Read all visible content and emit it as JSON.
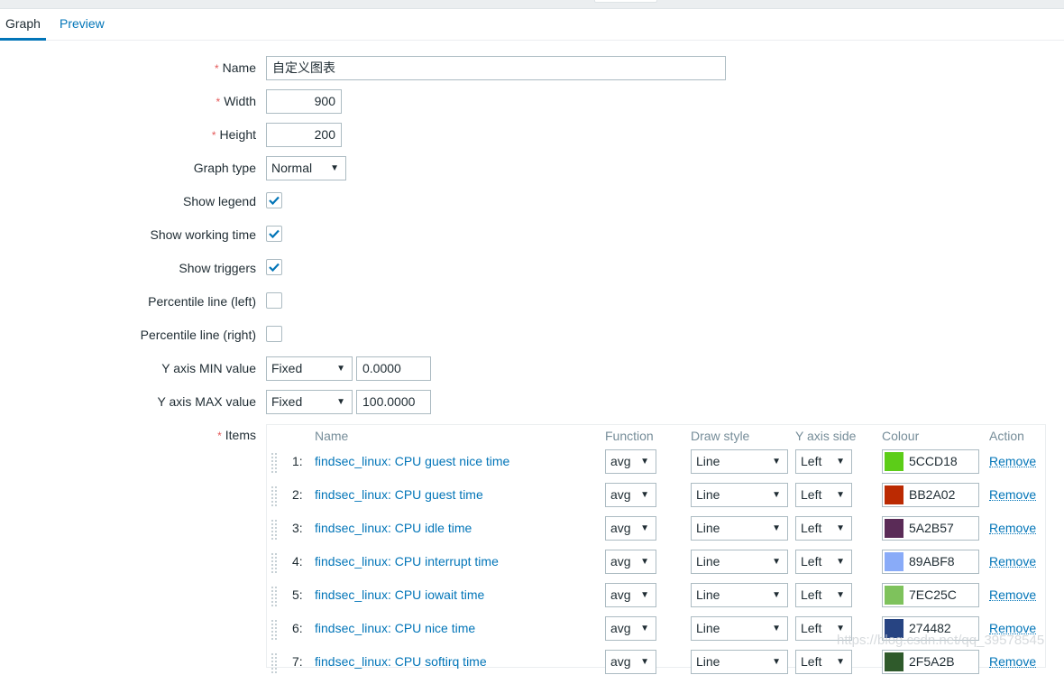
{
  "tabs": [
    {
      "label": "Graph",
      "active": true
    },
    {
      "label": "Preview",
      "active": false
    }
  ],
  "form": {
    "name": {
      "label": "Name",
      "required": true,
      "value": "自定义图表"
    },
    "width": {
      "label": "Width",
      "required": true,
      "value": "900"
    },
    "height": {
      "label": "Height",
      "required": true,
      "value": "200"
    },
    "graph_type": {
      "label": "Graph type",
      "value": "Normal"
    },
    "show_legend": {
      "label": "Show legend",
      "checked": true
    },
    "show_working_time": {
      "label": "Show working time",
      "checked": true
    },
    "show_triggers": {
      "label": "Show triggers",
      "checked": true
    },
    "percentile_left": {
      "label": "Percentile line (left)",
      "checked": false
    },
    "percentile_right": {
      "label": "Percentile line (right)",
      "checked": false
    },
    "y_min": {
      "label": "Y axis MIN value",
      "type": "Fixed",
      "value": "0.0000"
    },
    "y_max": {
      "label": "Y axis MAX value",
      "type": "Fixed",
      "value": "100.0000"
    },
    "items_label": "Items",
    "required_marker": "*"
  },
  "items_table": {
    "headers": {
      "name": "Name",
      "function": "Function",
      "draw_style": "Draw style",
      "y_axis_side": "Y axis side",
      "colour": "Colour",
      "action": "Action"
    },
    "rows": [
      {
        "num": "1:",
        "name": "findsec_linux: CPU guest nice time",
        "function": "avg",
        "draw_style": "Line",
        "y_axis_side": "Left",
        "colour": "5CCD18",
        "colour_hex": "#5CCD18",
        "action": "Remove"
      },
      {
        "num": "2:",
        "name": "findsec_linux: CPU guest time",
        "function": "avg",
        "draw_style": "Line",
        "y_axis_side": "Left",
        "colour": "BB2A02",
        "colour_hex": "#BB2A02",
        "action": "Remove"
      },
      {
        "num": "3:",
        "name": "findsec_linux: CPU idle time",
        "function": "avg",
        "draw_style": "Line",
        "y_axis_side": "Left",
        "colour": "5A2B57",
        "colour_hex": "#5A2B57",
        "action": "Remove"
      },
      {
        "num": "4:",
        "name": "findsec_linux: CPU interrupt time",
        "function": "avg",
        "draw_style": "Line",
        "y_axis_side": "Left",
        "colour": "89ABF8",
        "colour_hex": "#89ABF8",
        "action": "Remove"
      },
      {
        "num": "5:",
        "name": "findsec_linux: CPU iowait time",
        "function": "avg",
        "draw_style": "Line",
        "y_axis_side": "Left",
        "colour": "7EC25C",
        "colour_hex": "#7EC25C",
        "action": "Remove"
      },
      {
        "num": "6:",
        "name": "findsec_linux: CPU nice time",
        "function": "avg",
        "draw_style": "Line",
        "y_axis_side": "Left",
        "colour": "274482",
        "colour_hex": "#274482",
        "action": "Remove"
      },
      {
        "num": "7:",
        "name": "findsec_linux: CPU softirq time",
        "function": "avg",
        "draw_style": "Line",
        "y_axis_side": "Left",
        "colour": "2F5A2B",
        "colour_hex": "#2F5A2B",
        "action": "Remove"
      }
    ]
  },
  "icons": {
    "dropdown": "▼"
  },
  "watermark": "https://blog.csdn.net/qq_39578545"
}
